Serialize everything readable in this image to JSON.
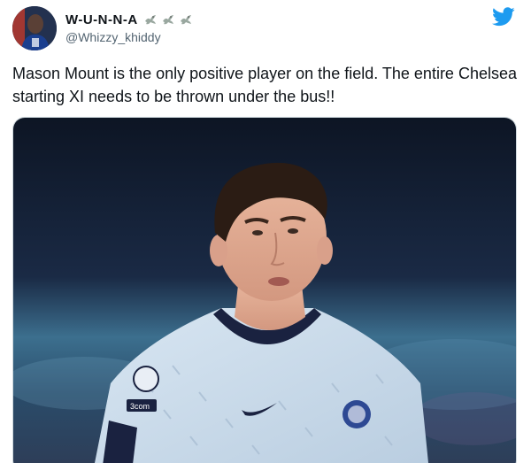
{
  "tweet": {
    "display_name": "W-U-N-N-A",
    "name_emojis": [
      "dove-icon",
      "dove-icon",
      "dove-icon"
    ],
    "handle": "@Whizzy_khiddy",
    "text": "Mason Mount is the only positive player on the field. The entire Chelsea starting XI needs to be thrown under the bus!!",
    "brand_icon": "twitter-bird-icon",
    "brand_color": "#1d9bf0"
  },
  "media": {
    "kind": "photo",
    "jersey_sponsor_text": "3com"
  }
}
